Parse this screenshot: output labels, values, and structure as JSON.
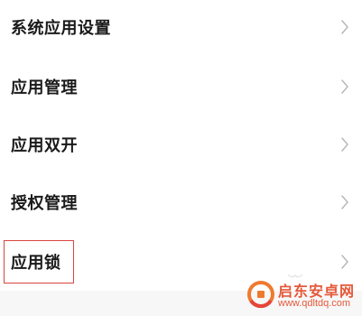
{
  "menu": {
    "items": [
      {
        "label": "系统应用设置"
      },
      {
        "label": "应用管理"
      },
      {
        "label": "应用双开"
      },
      {
        "label": "授权管理"
      },
      {
        "label": "应用锁"
      }
    ]
  },
  "highlight": {
    "target": "应用锁",
    "color": "#d9453f"
  },
  "watermark": {
    "title": "启东安卓网",
    "url": "www.qdltdq.com",
    "color": "#e5583a"
  },
  "icons": {
    "chevron": "chevron-right-icon",
    "logo": "watermark-logo-icon"
  }
}
